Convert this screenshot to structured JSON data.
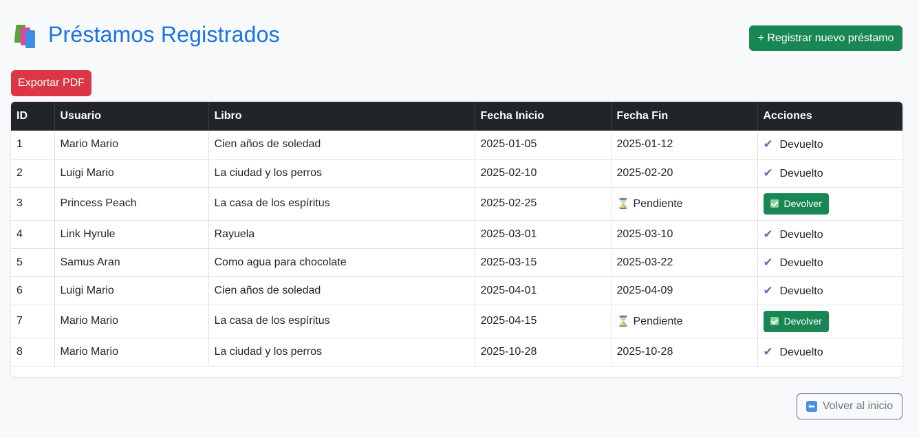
{
  "header": {
    "title": "Préstamos Registrados",
    "icon": "books-icon"
  },
  "actions": {
    "new_label": "+ Registrar nuevo préstamo",
    "export_label": "Exportar PDF",
    "back_label": "Volver al inicio"
  },
  "table": {
    "columns": [
      "ID",
      "Usuario",
      "Libro",
      "Fecha Inicio",
      "Fecha Fin",
      "Acciones"
    ],
    "rows": [
      {
        "id": "1",
        "usuario": "Mario Mario",
        "libro": "Cien años de soledad",
        "inicio": "2025-01-05",
        "fin": "2025-01-12",
        "accion": "Devuelto"
      },
      {
        "id": "2",
        "usuario": "Luigi Mario",
        "libro": "La ciudad y los perros",
        "inicio": "2025-02-10",
        "fin": "2025-02-20",
        "accion": "Devuelto"
      },
      {
        "id": "3",
        "usuario": "Princess Peach",
        "libro": "La casa de los espíritus",
        "inicio": "2025-02-25",
        "fin": "Pendiente",
        "accion": "Devolver"
      },
      {
        "id": "4",
        "usuario": "Link Hyrule",
        "libro": "Rayuela",
        "inicio": "2025-03-01",
        "fin": "2025-03-10",
        "accion": "Devuelto"
      },
      {
        "id": "5",
        "usuario": "Samus Aran",
        "libro": "Como agua para chocolate",
        "inicio": "2025-03-15",
        "fin": "2025-03-22",
        "accion": "Devuelto"
      },
      {
        "id": "6",
        "usuario": "Luigi Mario",
        "libro": "Cien años de soledad",
        "inicio": "2025-04-01",
        "fin": "2025-04-09",
        "accion": "Devuelto"
      },
      {
        "id": "7",
        "usuario": "Mario Mario",
        "libro": "La casa de los espíritus",
        "inicio": "2025-04-15",
        "fin": "Pendiente",
        "accion": "Devolver"
      },
      {
        "id": "8",
        "usuario": "Mario Mario",
        "libro": "La ciudad y los perros",
        "inicio": "2025-10-28",
        "fin": "2025-10-28",
        "accion": "Devuelto"
      }
    ]
  },
  "colors": {
    "title": "#1a73e8",
    "success": "#198754",
    "danger": "#dc3545",
    "header_bg": "#212529",
    "check": "#7b5cc9"
  }
}
